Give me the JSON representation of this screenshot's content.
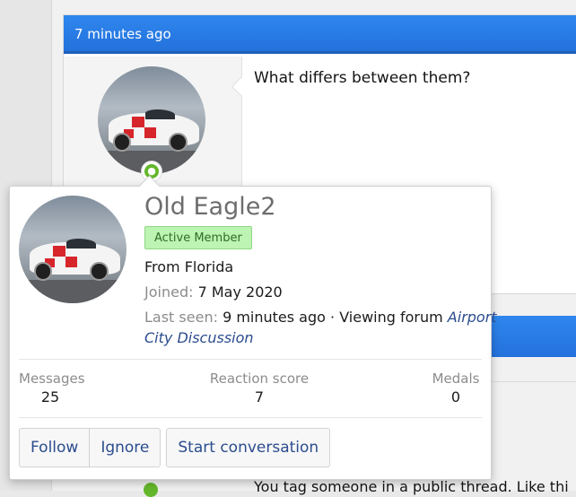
{
  "post": {
    "timestamp": "7 minutes ago",
    "message": "What differs between them?"
  },
  "next_post": {
    "message_preview": "You tag someone in a public thread. Like thi"
  },
  "user_tooltip": {
    "username": "Old Eagle2",
    "badge": "Active Member",
    "location": "From Florida",
    "joined_label": "Joined:",
    "joined_value": "7 May 2020",
    "last_seen_label": "Last seen:",
    "last_seen_value": "9 minutes ago · Viewing forum ",
    "last_seen_link_line1": "Airport",
    "last_seen_link_line2": "City Discussion",
    "stats": [
      {
        "label": "Messages",
        "value": "25"
      },
      {
        "label": "Reaction score",
        "value": "7"
      },
      {
        "label": "Medals",
        "value": "0"
      }
    ],
    "buttons": {
      "follow": "Follow",
      "ignore": "Ignore",
      "start_conversation": "Start conversation"
    }
  },
  "icons": {
    "online_status": "user-online-icon"
  },
  "colors": {
    "header_blue": "#2a7ce6",
    "badge_green": "#bdf3b3",
    "link_blue": "#2b4c8e",
    "online_green": "#63b72a"
  }
}
